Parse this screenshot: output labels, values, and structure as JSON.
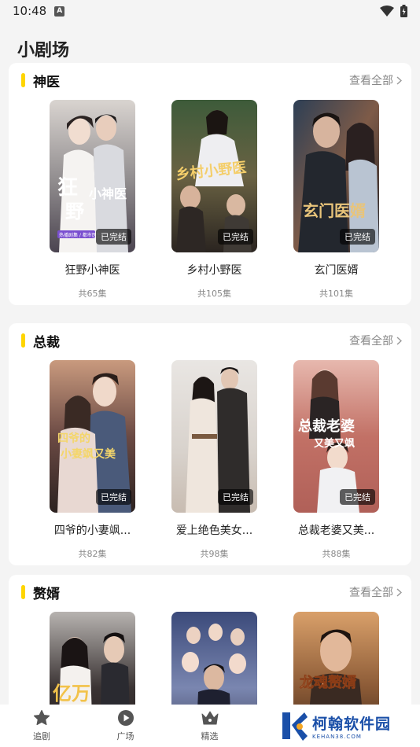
{
  "status_bar": {
    "time": "10:48",
    "notif_icon": "A"
  },
  "page": {
    "title": "小剧场"
  },
  "sections": [
    {
      "title": "神医",
      "view_all": "查看全部",
      "items": [
        {
          "title": "狂野小神医",
          "episodes": "共65集",
          "status": "已完结",
          "poster_text": "狂野小神医",
          "colors": [
            "#d9d4d0",
            "#8e8a8c",
            "#4b4450"
          ]
        },
        {
          "title": "乡村小野医",
          "episodes": "共105集",
          "status": "已完结",
          "poster_text": "乡村小野医",
          "colors": [
            "#3d5b3a",
            "#6a6243",
            "#2a2420"
          ]
        },
        {
          "title": "玄门医婿",
          "episodes": "共101集",
          "status": "已完结",
          "poster_text": "玄门医婿",
          "colors": [
            "#2d3f55",
            "#7e5b48",
            "#1c1c22"
          ]
        }
      ]
    },
    {
      "title": "总裁",
      "view_all": "查看全部",
      "items": [
        {
          "title": "四爷的小妻飒...",
          "episodes": "共82集",
          "status": "已完结",
          "poster_text": "四爷的小妻飒又美",
          "colors": [
            "#c99a7e",
            "#6b4a44",
            "#2c2220"
          ]
        },
        {
          "title": "爱上绝色美女...",
          "episodes": "共98集",
          "status": "已完结",
          "poster_text": "",
          "colors": [
            "#e9e6e3",
            "#c8bcb1",
            "#3b3837"
          ]
        },
        {
          "title": "总裁老婆又美...",
          "episodes": "共88集",
          "status": "已完结",
          "poster_text": "总裁老婆又美又飒",
          "colors": [
            "#e7b8ae",
            "#c27166",
            "#e8e0df"
          ]
        }
      ]
    },
    {
      "title": "赘婿",
      "view_all": "查看全部",
      "items": [
        {
          "title": "",
          "episodes": "",
          "status": "",
          "poster_text": "亿万",
          "colors": [
            "#b7b3b0",
            "#3a3333",
            "#1c1616"
          ]
        },
        {
          "title": "",
          "episodes": "",
          "status": "",
          "poster_text": "",
          "colors": [
            "#3b4a7a",
            "#7a86b0",
            "#2a2c40"
          ]
        },
        {
          "title": "",
          "episodes": "",
          "status": "",
          "poster_text": "龙魂赘婿",
          "colors": [
            "#d9a06a",
            "#8b5a36",
            "#2a1a12"
          ]
        }
      ]
    }
  ],
  "bottom_nav": [
    {
      "label": "追剧",
      "icon": "star-icon"
    },
    {
      "label": "广场",
      "icon": "play-icon"
    },
    {
      "label": "精选",
      "icon": "crown-icon"
    }
  ],
  "watermark": {
    "main": "柯翰软件园",
    "sub": "KEHAN38.COM"
  },
  "accent_color": "#ffd500"
}
